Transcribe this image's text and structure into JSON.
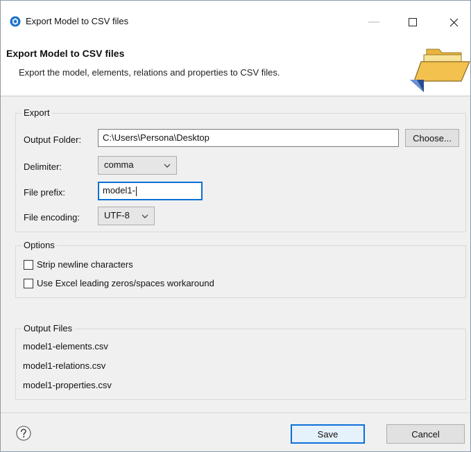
{
  "window": {
    "title": "Export Model to CSV files",
    "controls": {
      "minimize": "—",
      "maximize": "☐",
      "close": "✕"
    }
  },
  "banner": {
    "title": "Export Model to CSV files",
    "description": "Export the model, elements, relations and properties to CSV files."
  },
  "export_group": {
    "legend": "Export",
    "output_folder_label": "Output Folder:",
    "output_folder_value": "C:\\Users\\Persona\\Desktop",
    "choose_button": "Choose...",
    "delimiter_label": "Delimiter:",
    "delimiter_value": "comma",
    "file_prefix_label": "File prefix:",
    "file_prefix_value": "model1-",
    "file_encoding_label": "File encoding:",
    "file_encoding_value": "UTF-8"
  },
  "options_group": {
    "legend": "Options",
    "strip_newline_label": "Strip newline characters",
    "strip_newline_checked": false,
    "excel_workaround_label": "Use Excel leading zeros/spaces workaround",
    "excel_workaround_checked": false
  },
  "output_files_group": {
    "legend": "Output Files",
    "files": [
      "model1-elements.csv",
      "model1-relations.csv",
      "model1-properties.csv"
    ]
  },
  "footer": {
    "help_icon": "question-mark-icon",
    "save_button": "Save",
    "cancel_button": "Cancel"
  },
  "colors": {
    "accent": "#0a6fd6",
    "app_icon": "#1a73c8",
    "folder": "#f2c14e"
  }
}
